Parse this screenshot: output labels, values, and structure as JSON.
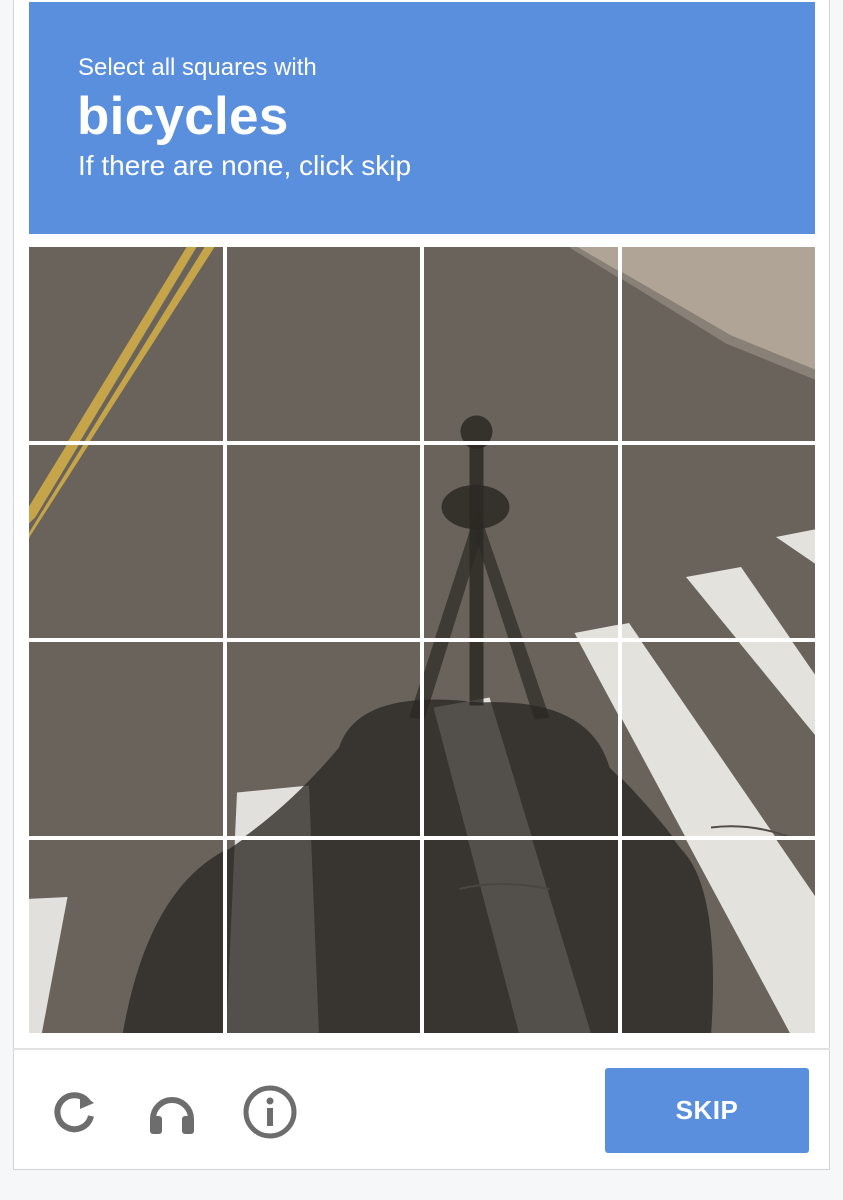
{
  "challenge": {
    "instruction": "Select all squares with",
    "target_object": "bicycles",
    "hint": "If there are none, click skip"
  },
  "grid": {
    "rows": 4,
    "columns": 4,
    "selected_tiles": []
  },
  "footer": {
    "reload_icon": "reload-icon",
    "audio_icon": "headphones-icon",
    "info_icon": "info-icon",
    "skip_label": "SKIP"
  },
  "colors": {
    "header_bg": "#5a8fdd",
    "button_bg": "#5a8fdd",
    "asphalt": "#6f685f",
    "icon_gray": "#6d6d6d"
  }
}
